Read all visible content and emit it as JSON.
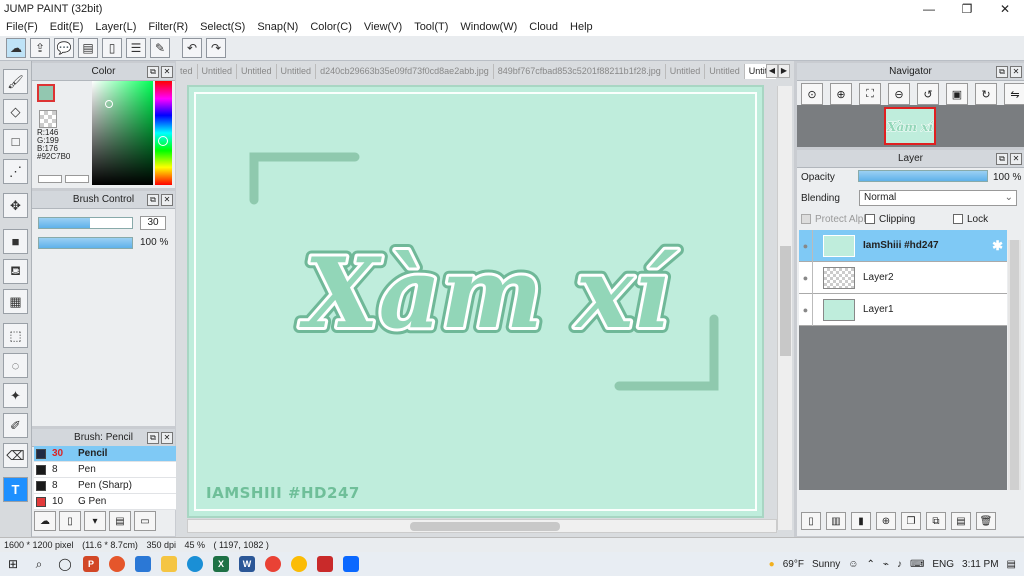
{
  "window": {
    "title": "JUMP PAINT (32bit)",
    "minimize": "—",
    "restore": "❐",
    "close": "✕"
  },
  "menu": [
    "File(F)",
    "Edit(E)",
    "Layer(L)",
    "Filter(R)",
    "Select(S)",
    "Snap(N)",
    "Color(C)",
    "View(V)",
    "Tool(T)",
    "Window(W)",
    "Cloud",
    "Help"
  ],
  "toolbar": {
    "icons": [
      "cloud-icon",
      "share-icon",
      "comment-icon",
      "comment-box-icon",
      "page-icon",
      "page-list-icon",
      "page-edit-icon"
    ],
    "undo": "↶",
    "redo": "↷"
  },
  "tools": [
    "brush-icon",
    "eraser-icon",
    "rect-icon",
    "dot-line-icon",
    "move-icon",
    "fill-rect-icon",
    "bucket-icon",
    "gradient-icon",
    "select-rect-icon",
    "lasso-icon",
    "magic-wand-icon",
    "select-pen-icon",
    "select-eraser-icon",
    "text-icon"
  ],
  "tool_text": "T",
  "color_panel": {
    "title": "Color",
    "current_color": "#92C7B0",
    "r": "R:146",
    "g": "G:199",
    "b": "B:176",
    "hex": "#92C7B0"
  },
  "brush_control": {
    "title": "Brush Control",
    "size_value": "30",
    "size_fraction": 0.55,
    "opacity_value": "100 %",
    "opacity_fraction": 1.0
  },
  "brush_list": {
    "title": "Brush: Pencil",
    "items": [
      {
        "size": "30",
        "name": "Pencil",
        "color": "#1f2a44",
        "selected": true
      },
      {
        "size": "8",
        "name": "Pen",
        "color": "#1a1a1a",
        "selected": false
      },
      {
        "size": "8",
        "name": "Pen (Sharp)",
        "color": "#1a1a1a",
        "selected": false
      },
      {
        "size": "10",
        "name": "G Pen",
        "color": "#e23b3b",
        "selected": false
      }
    ]
  },
  "tabs": [
    "ted",
    "Untitled",
    "Untitled",
    "Untitled",
    "d240cb29663b35e09fd73f0cd8ae2abb.jpg",
    "849bf767cfbad853c5201f88211b1f28.jpg",
    "Untitled",
    "Untitled",
    "Untitled"
  ],
  "canvas": {
    "background": "#bfeddc",
    "lettering": "Xàm xí",
    "signature": "IAMSHIII #HD247"
  },
  "navigator": {
    "title": "Navigator",
    "thumb_text": "Xàm xí"
  },
  "layer_panel": {
    "title": "Layer",
    "opacity_label": "Opacity",
    "opacity_value": "100 %",
    "opacity_fraction": 1.0,
    "blending_label": "Blending",
    "blending_value": "Normal",
    "protect_alpha": "Protect Alpha",
    "clipping": "Clipping",
    "lock": "Lock",
    "layers": [
      {
        "name": "IamShiii #hd247",
        "selected": true
      },
      {
        "name": "Layer2",
        "selected": false
      },
      {
        "name": "Layer1",
        "selected": false
      }
    ]
  },
  "status": {
    "size": "1600 * 1200 pixel",
    "cm": "(11.6 * 8.7cm)",
    "dpi": "350 dpi",
    "zoom": "45 %",
    "coords": "( 1197, 1082 )"
  },
  "taskbar": {
    "weather_temp": "69°F",
    "weather_text": "Sunny",
    "lang": "ENG",
    "time": "3:11 PM"
  }
}
